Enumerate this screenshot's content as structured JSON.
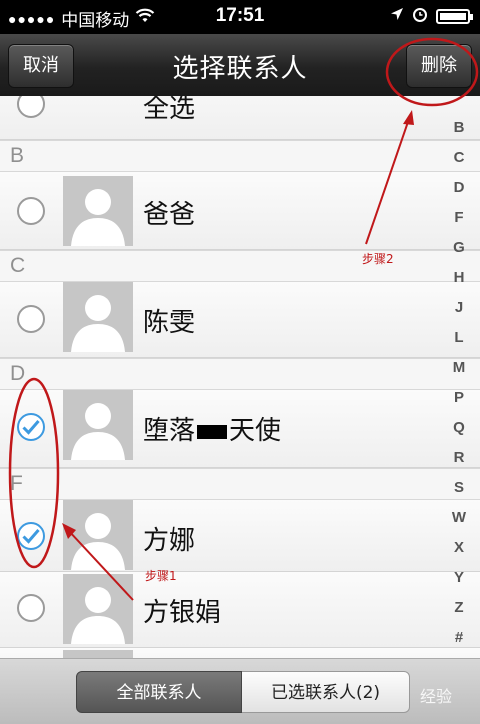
{
  "status_bar": {
    "signal_dots": "●●●●●",
    "carrier": "中国移动",
    "wifi_icon": "wifi-icon",
    "time": "17:51",
    "location_icon": "location-arrow-icon",
    "alarm_icon": "alarm-clock-icon",
    "battery_icon": "battery-icon"
  },
  "nav": {
    "cancel_label": "取消",
    "title": "选择联系人",
    "delete_label": "删除"
  },
  "list": {
    "select_all_label": "全选",
    "sections": [
      {
        "letter": "B"
      },
      {
        "letter": "C"
      },
      {
        "letter": "D"
      },
      {
        "letter": "F"
      }
    ],
    "contacts": [
      {
        "name": "爸爸",
        "checked": false
      },
      {
        "name": "陈雯",
        "checked": false
      },
      {
        "name_part1": "堕落",
        "name_part2": "天使",
        "checked": true
      },
      {
        "name": "方娜",
        "checked": true
      },
      {
        "name": "方银娟",
        "checked": false
      }
    ]
  },
  "index_bar": [
    "B",
    "C",
    "D",
    "F",
    "G",
    "H",
    "J",
    "L",
    "M",
    "P",
    "Q",
    "R",
    "S",
    "W",
    "X",
    "Y",
    "Z",
    "#"
  ],
  "bottom_tabs": {
    "all_label": "全部联系人",
    "selected_label": "已选联系人(2)"
  },
  "watermark": "经验",
  "annotations": {
    "step1": "步骤1",
    "step2": "步骤2",
    "color": "#c0181a"
  },
  "colors": {
    "check": "#3d9ae0",
    "nav_bar": "#2a2a2a"
  }
}
